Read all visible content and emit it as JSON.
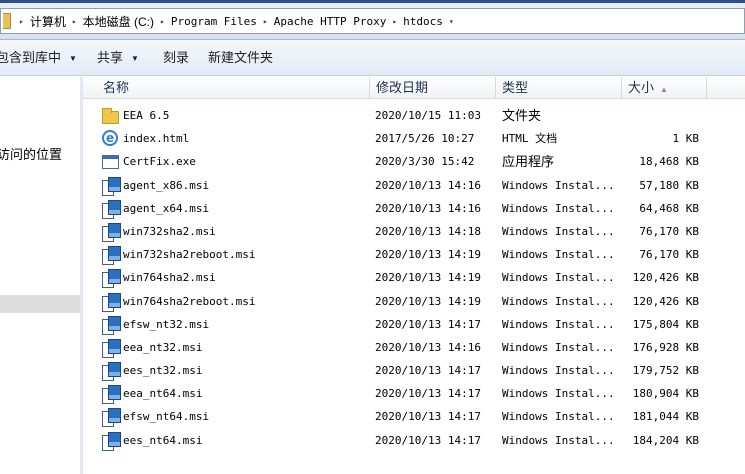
{
  "address": {
    "breadcrumbs": [
      "计算机",
      "本地磁盘 (C:)",
      "Program Files",
      "Apache HTTP Proxy",
      "htdocs"
    ]
  },
  "toolbar": {
    "include_label": "包含到库中",
    "share_label": "共享",
    "burn_label": "刻录",
    "new_folder_label": "新建文件夹"
  },
  "nav": {
    "recent_places": "访问的位置"
  },
  "columns": {
    "name": "名称",
    "date": "修改日期",
    "type": "类型",
    "size": "大小"
  },
  "files": [
    {
      "name": "EEA 6.5",
      "date": "2020/10/15 11:03",
      "type": "文件夹",
      "size": "",
      "icon": "folder-icon"
    },
    {
      "name": "index.html",
      "date": "2017/5/26 10:27",
      "type": "HTML 文档",
      "size": "1 KB",
      "icon": "html-file-icon"
    },
    {
      "name": "CertFix.exe",
      "date": "2020/3/30 15:42",
      "type": "应用程序",
      "size": "18,468 KB",
      "icon": "exe-file-icon"
    },
    {
      "name": "agent_x86.msi",
      "date": "2020/10/13 14:16",
      "type": "Windows Instal...",
      "size": "57,180 KB",
      "icon": "msi-file-icon"
    },
    {
      "name": "agent_x64.msi",
      "date": "2020/10/13 14:16",
      "type": "Windows Instal...",
      "size": "64,468 KB",
      "icon": "msi-file-icon"
    },
    {
      "name": "win732sha2.msi",
      "date": "2020/10/13 14:18",
      "type": "Windows Instal...",
      "size": "76,170 KB",
      "icon": "msi-file-icon"
    },
    {
      "name": "win732sha2reboot.msi",
      "date": "2020/10/13 14:19",
      "type": "Windows Instal...",
      "size": "76,170 KB",
      "icon": "msi-file-icon"
    },
    {
      "name": "win764sha2.msi",
      "date": "2020/10/13 14:19",
      "type": "Windows Instal...",
      "size": "120,426 KB",
      "icon": "msi-file-icon"
    },
    {
      "name": "win764sha2reboot.msi",
      "date": "2020/10/13 14:19",
      "type": "Windows Instal...",
      "size": "120,426 KB",
      "icon": "msi-file-icon"
    },
    {
      "name": "efsw_nt32.msi",
      "date": "2020/10/13 14:17",
      "type": "Windows Instal...",
      "size": "175,804 KB",
      "icon": "msi-file-icon"
    },
    {
      "name": "eea_nt32.msi",
      "date": "2020/10/13 14:16",
      "type": "Windows Instal...",
      "size": "176,928 KB",
      "icon": "msi-file-icon"
    },
    {
      "name": "ees_nt32.msi",
      "date": "2020/10/13 14:17",
      "type": "Windows Instal...",
      "size": "179,752 KB",
      "icon": "msi-file-icon"
    },
    {
      "name": "eea_nt64.msi",
      "date": "2020/10/13 14:17",
      "type": "Windows Instal...",
      "size": "180,904 KB",
      "icon": "msi-file-icon"
    },
    {
      "name": "efsw_nt64.msi",
      "date": "2020/10/13 14:17",
      "type": "Windows Instal...",
      "size": "181,044 KB",
      "icon": "msi-file-icon"
    },
    {
      "name": "ees_nt64.msi",
      "date": "2020/10/13 14:17",
      "type": "Windows Instal...",
      "size": "184,204 KB",
      "icon": "msi-file-icon"
    }
  ]
}
